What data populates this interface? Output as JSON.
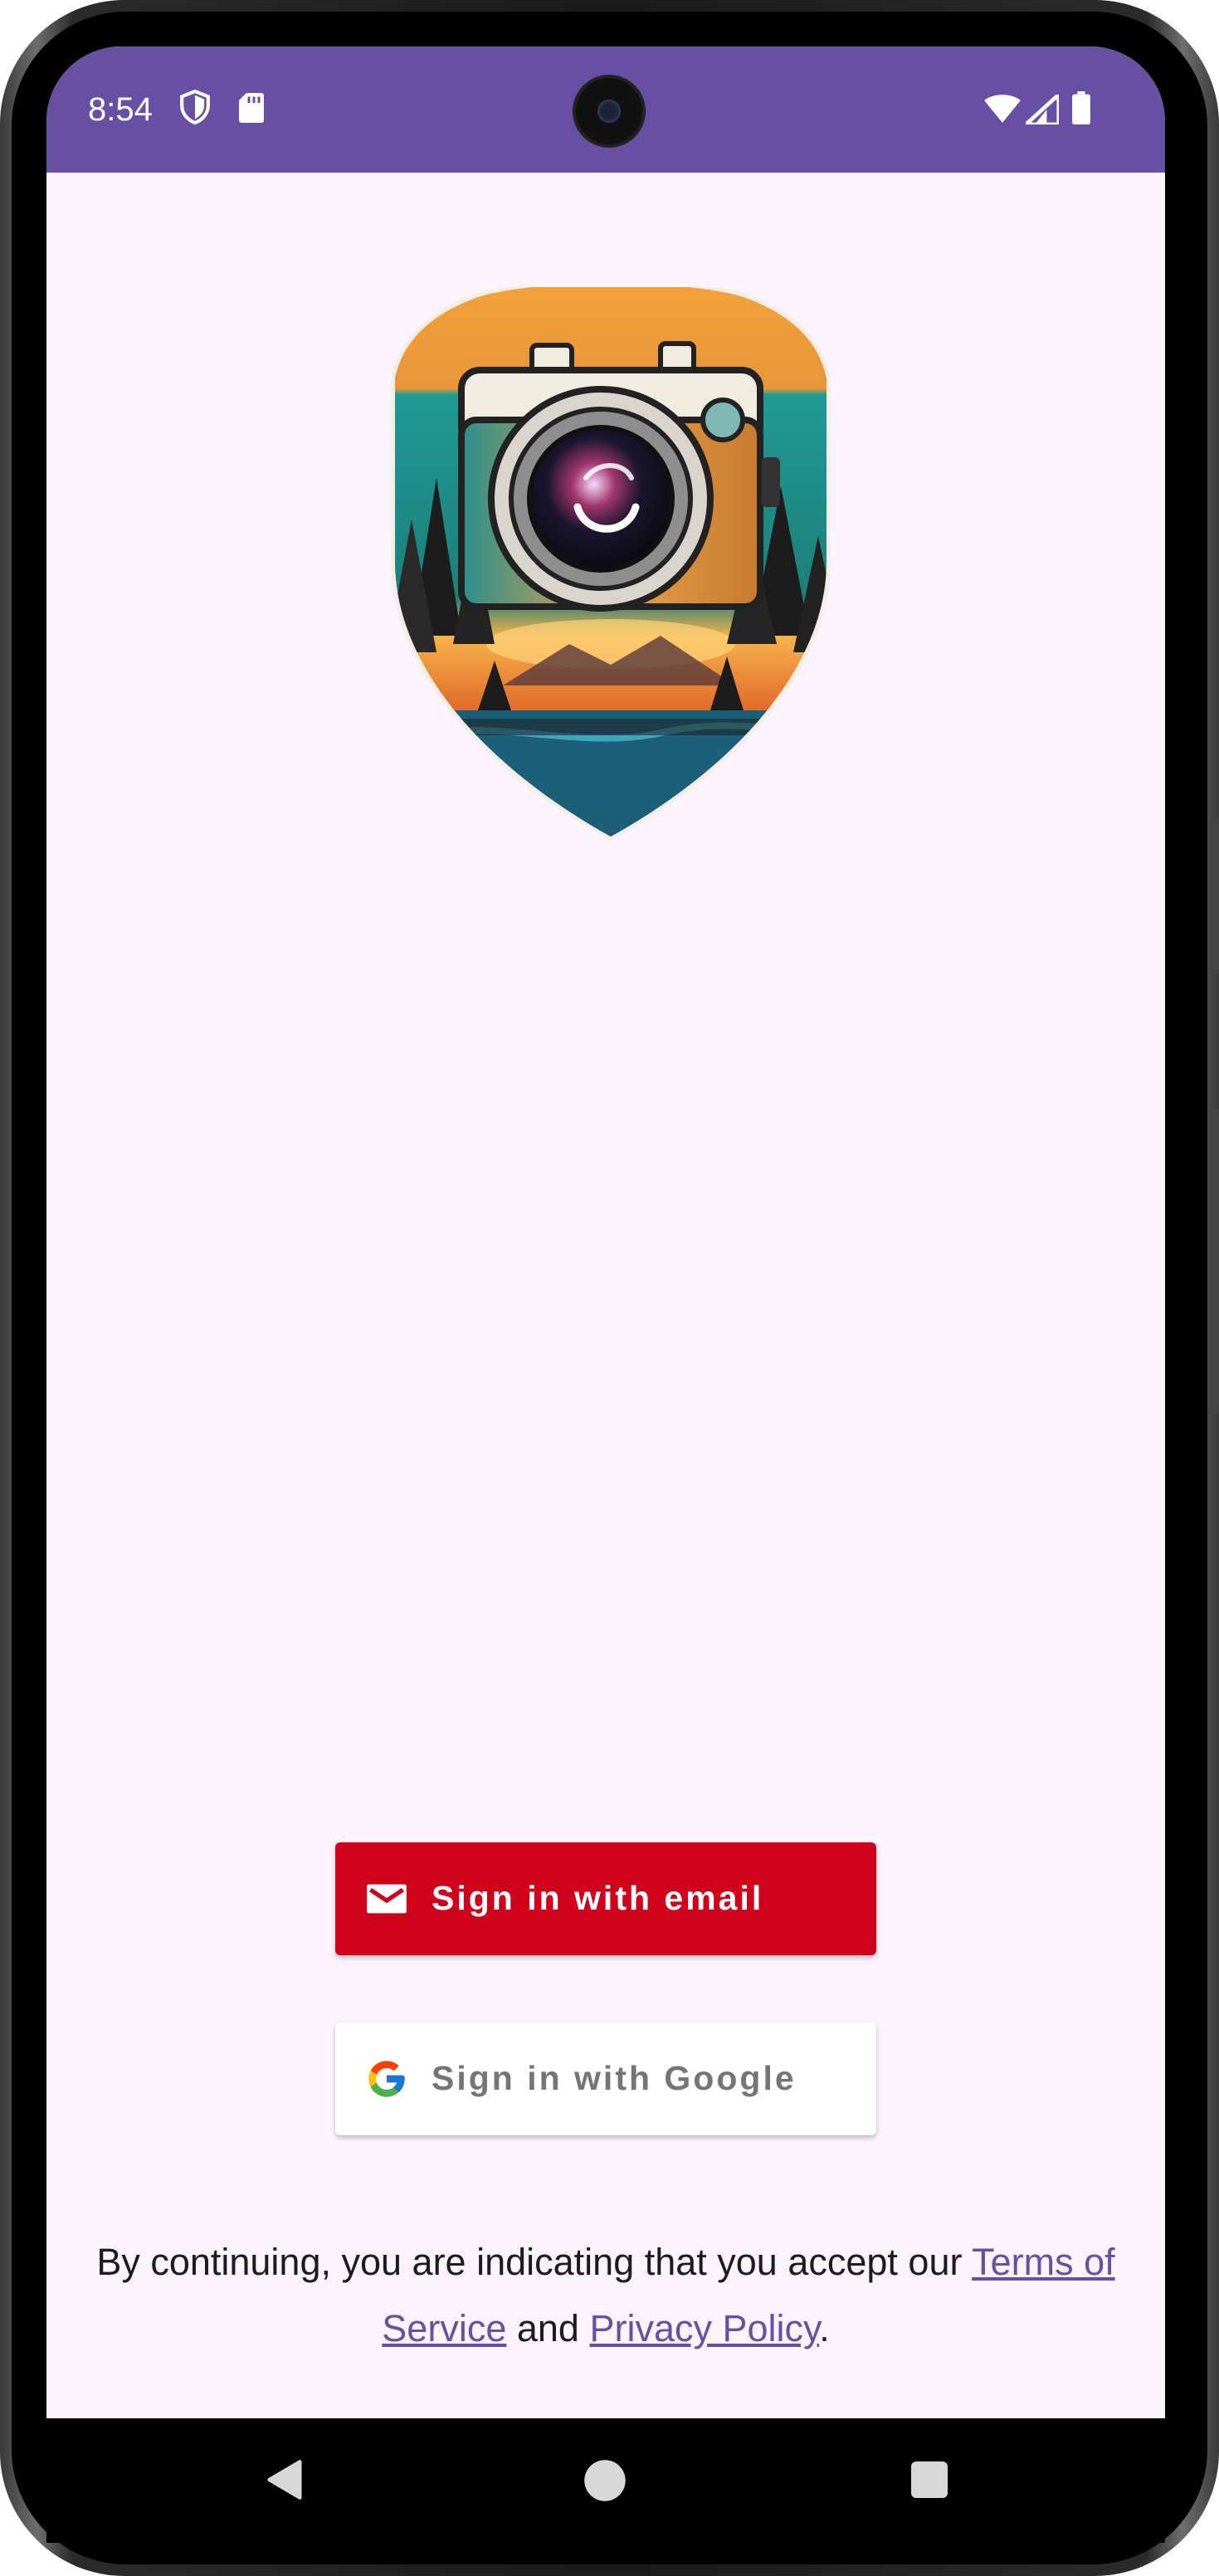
{
  "status_bar": {
    "time": "8:54",
    "left_icons": [
      "shield-icon",
      "sd-card-icon"
    ],
    "right_icons": [
      "wifi-icon",
      "cell-signal-icon",
      "battery-icon"
    ],
    "background_color": "#6750a4"
  },
  "logo": {
    "icon": "camera-shield-logo"
  },
  "buttons": {
    "email": {
      "label": "Sign in with email",
      "icon": "mail-icon",
      "background_color": "#d0021b"
    },
    "google": {
      "label": "Sign in with Google",
      "icon": "google-icon",
      "background_color": "#ffffff"
    }
  },
  "terms": {
    "prefix": "By continuing, you are indicating that you accept our ",
    "terms_link": "Terms of Service",
    "middle": " and ",
    "privacy_link": "Privacy Policy",
    "suffix": "."
  },
  "nav_bar": {
    "icons": [
      "back-icon",
      "home-icon",
      "recents-icon"
    ]
  },
  "colors": {
    "accent": "#6750a4",
    "screen_background": "#fcf4fc"
  }
}
